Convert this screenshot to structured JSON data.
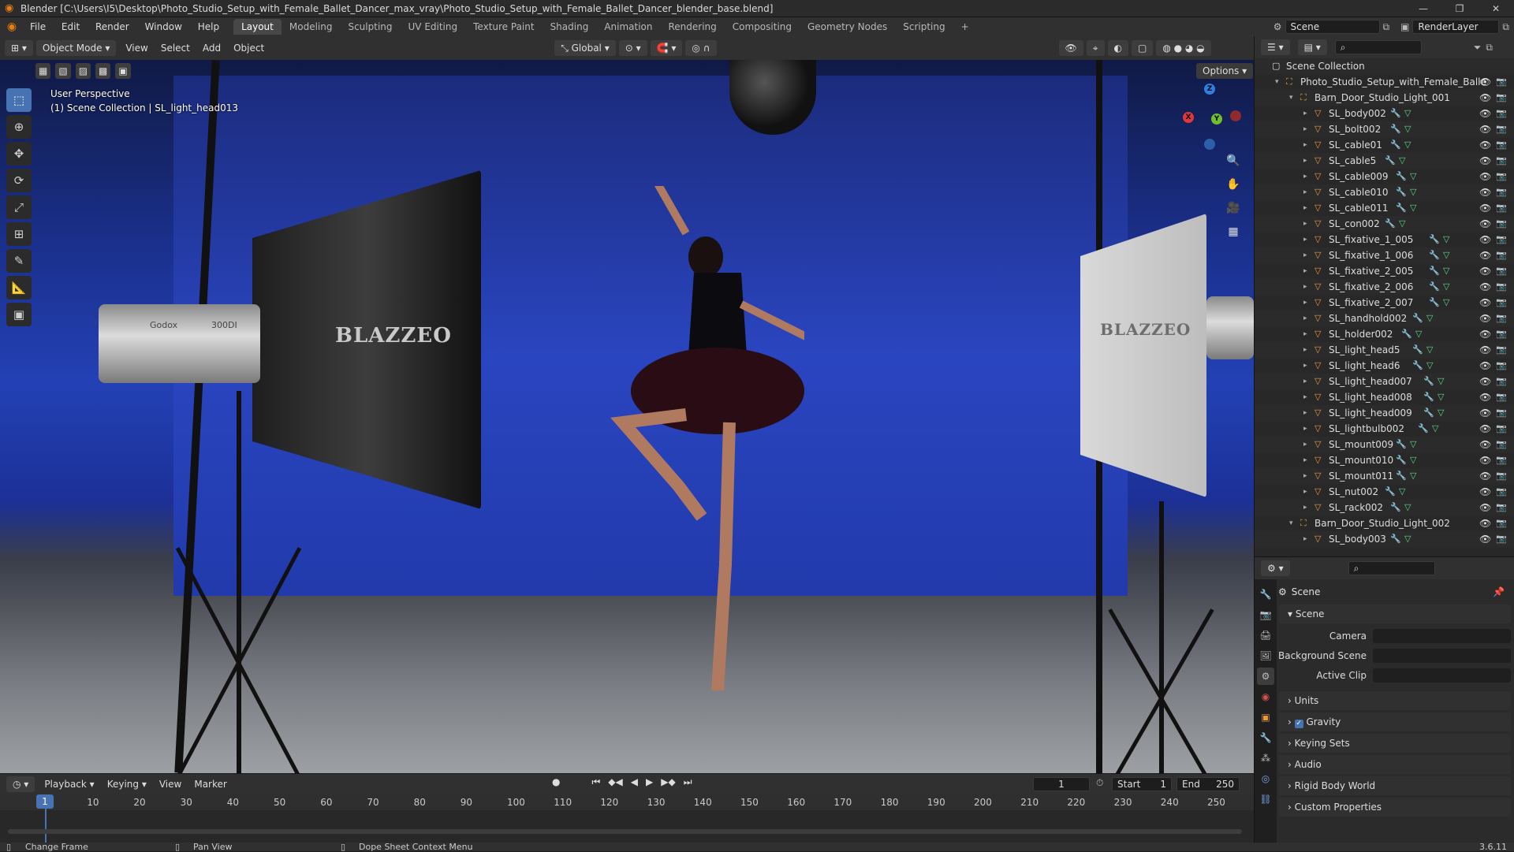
{
  "window": {
    "title": "Blender [C:\\Users\\I5\\Desktop\\Photo_Studio_Setup_with_Female_Ballet_Dancer_max_vray\\Photo_Studio_Setup_with_Female_Ballet_Dancer_blender_base.blend]",
    "controls": [
      "—",
      "❐",
      "✕"
    ]
  },
  "menu": [
    "File",
    "Edit",
    "Render",
    "Window",
    "Help"
  ],
  "workspaces": [
    "Layout",
    "Modeling",
    "Sculpting",
    "UV Editing",
    "Texture Paint",
    "Shading",
    "Animation",
    "Rendering",
    "Compositing",
    "Geometry Nodes",
    "Scripting",
    "+"
  ],
  "active_workspace": "Layout",
  "scene_name": "Scene",
  "render_layer": "RenderLayer",
  "viewport_header": {
    "mode": "Object Mode",
    "menus": [
      "View",
      "Select",
      "Add",
      "Object"
    ],
    "transform": "Global"
  },
  "viewport": {
    "perspective": "User Perspective",
    "collection_info": "(1) Scene Collection | SL_light_head013",
    "options": "Options",
    "softbox_brand": "BLAZZEO",
    "lamp_brand": "Godox",
    "lamp_model": "300DI"
  },
  "gizmo": {
    "x": "X",
    "y": "Y",
    "z": "Z"
  },
  "outliner": {
    "root": "Scene Collection",
    "collection": "Photo_Studio_Setup_with_Female_Balle",
    "group1": "Barn_Door_Studio_Light_001",
    "items": [
      "SL_body002",
      "SL_bolt002",
      "SL_cable01",
      "SL_cable5",
      "SL_cable009",
      "SL_cable010",
      "SL_cable011",
      "SL_con002",
      "SL_fixative_1_005",
      "SL_fixative_1_006",
      "SL_fixative_2_005",
      "SL_fixative_2_006",
      "SL_fixative_2_007",
      "SL_handhold002",
      "SL_holder002",
      "SL_light_head5",
      "SL_light_head6",
      "SL_light_head007",
      "SL_light_head008",
      "SL_light_head009",
      "SL_lightbulb002",
      "SL_mount009",
      "SL_mount010",
      "SL_mount011",
      "SL_nut002",
      "SL_rack002"
    ],
    "group2": "Barn_Door_Studio_Light_002",
    "items2": [
      "SL_body003"
    ]
  },
  "properties": {
    "context": "Scene",
    "section": "Scene",
    "camera_label": "Camera",
    "bg_scene_label": "Background Scene",
    "active_clip_label": "Active Clip",
    "panels": [
      "Units",
      "Gravity",
      "Keying Sets",
      "Audio",
      "Rigid Body World",
      "Custom Properties"
    ]
  },
  "timeline": {
    "menus": [
      "Playback",
      "Keying",
      "View",
      "Marker"
    ],
    "current_frame": "1",
    "start_label": "Start",
    "start": "1",
    "end_label": "End",
    "end": "250",
    "ticks": [
      "10",
      "20",
      "30",
      "40",
      "50",
      "60",
      "70",
      "80",
      "90",
      "100",
      "110",
      "120",
      "130",
      "140",
      "150",
      "160",
      "170",
      "180",
      "190",
      "200",
      "210",
      "220",
      "230",
      "240",
      "250"
    ],
    "playhead": "1"
  },
  "status": {
    "left": "Change Frame",
    "middle": "Pan View",
    "right": "Dope Sheet Context Menu",
    "version": "3.6.11"
  }
}
